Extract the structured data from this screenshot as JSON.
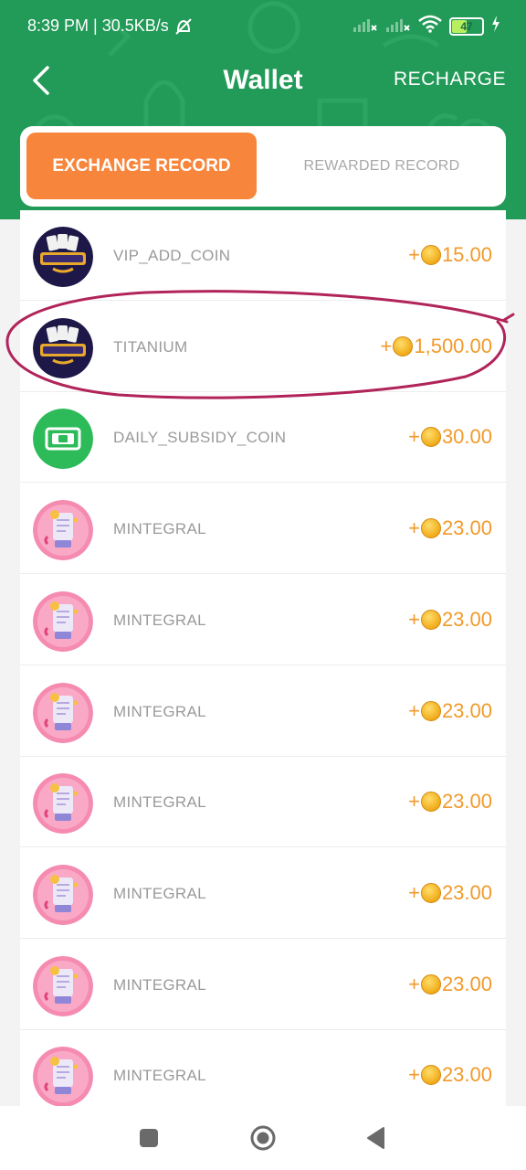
{
  "status_bar": {
    "time": "8:39 PM",
    "speed": "30.5KB/s",
    "battery": "47",
    "battery_level": 0.47
  },
  "header": {
    "title": "Wallet",
    "recharge_label": "RECHARGE"
  },
  "tabs": [
    {
      "label": "EXCHANGE RECORD",
      "active": true
    },
    {
      "label": "REWARDED RECORD",
      "active": false
    }
  ],
  "records": [
    {
      "name": "VIP_ADD_COIN",
      "sign": "+",
      "amount": "15.00",
      "icon": "tangos-club-logo"
    },
    {
      "name": "TITANIUM",
      "sign": "+",
      "amount": "1,500.00",
      "icon": "tangos-club-logo"
    },
    {
      "name": "DAILY_SUBSIDY_COIN",
      "sign": "+",
      "amount": "30.00",
      "icon": "cash-icon"
    },
    {
      "name": "MINTEGRAL",
      "sign": "+",
      "amount": "23.00",
      "icon": "mintegral-icon"
    },
    {
      "name": "MINTEGRAL",
      "sign": "+",
      "amount": "23.00",
      "icon": "mintegral-icon"
    },
    {
      "name": "MINTEGRAL",
      "sign": "+",
      "amount": "23.00",
      "icon": "mintegral-icon"
    },
    {
      "name": "MINTEGRAL",
      "sign": "+",
      "amount": "23.00",
      "icon": "mintegral-icon"
    },
    {
      "name": "MINTEGRAL",
      "sign": "+",
      "amount": "23.00",
      "icon": "mintegral-icon"
    },
    {
      "name": "MINTEGRAL",
      "sign": "+",
      "amount": "23.00",
      "icon": "mintegral-icon"
    },
    {
      "name": "MINTEGRAL",
      "sign": "+",
      "amount": "23.00",
      "icon": "mintegral-icon"
    }
  ],
  "colors": {
    "header": "#229a58",
    "accent": "#f7853b",
    "amount": "#f19a2a",
    "annotation": "#b1245a"
  }
}
